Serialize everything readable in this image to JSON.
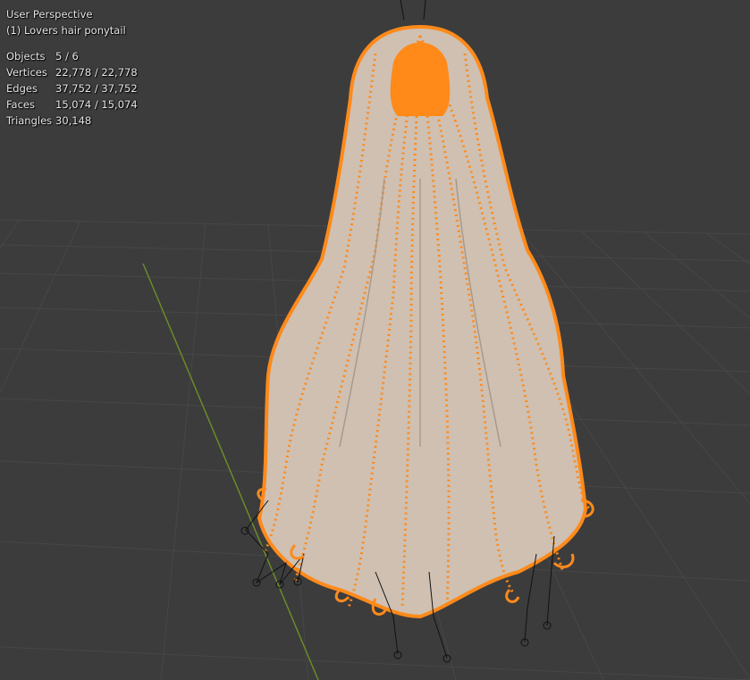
{
  "viewport": {
    "view_title": "User Perspective",
    "object_name": "(1) Lovers hair ponytail",
    "stats": [
      {
        "label": "Objects",
        "value": "5 / 6"
      },
      {
        "label": "Vertices",
        "value": "22,778 / 22,778"
      },
      {
        "label": "Edges",
        "value": "37,752 / 37,752"
      },
      {
        "label": "Faces",
        "value": "15,074 / 15,074"
      },
      {
        "label": "Triangles",
        "value": "30,148"
      }
    ]
  },
  "colors": {
    "background": "#3c3c3c",
    "grid": "#4a4a4a",
    "y_axis": "#6b8a2a",
    "selection": "#ff8a1a",
    "mesh": "#d7c8bb",
    "armature": "#111111"
  },
  "scene_objects": [
    "hair-mesh",
    "armature-bones",
    "grid-floor",
    "y-axis-line"
  ]
}
